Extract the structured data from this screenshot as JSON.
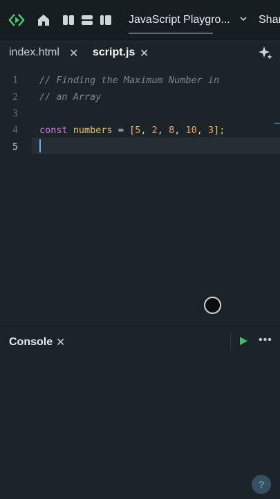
{
  "topbar": {
    "project_title": "JavaScript Playgro...",
    "share_label": "Shar",
    "icons": [
      "replit-logo-icon",
      "home-icon",
      "split-panes-icon",
      "stacked-panes-icon",
      "sidebar-toggle-icon",
      "chevron-down-icon"
    ]
  },
  "tabs": [
    {
      "label": "index.html",
      "active": false
    },
    {
      "label": "script.js",
      "active": true
    }
  ],
  "editor": {
    "line_numbers": [
      "1",
      "2",
      "3",
      "4",
      "5"
    ],
    "lines": {
      "l1": "// Finding the Maximum Number in",
      "l2": "// an Array",
      "l4": {
        "keyword": "const",
        "name": "numbers",
        "eq": "=",
        "open": "[",
        "values": [
          "5",
          "2",
          "8",
          "10",
          "3"
        ],
        "close": "];"
      }
    },
    "current_line": "5"
  },
  "console": {
    "title": "Console",
    "more_label": "•••",
    "help_label": "?"
  },
  "colors": {
    "background": "#1b2428",
    "keyword": "#d67ae4",
    "variable": "#e9c46a",
    "number": "#f0a45d",
    "comment": "#7f8b90",
    "run": "#3fbf5f",
    "accent": "#58b9ff"
  }
}
